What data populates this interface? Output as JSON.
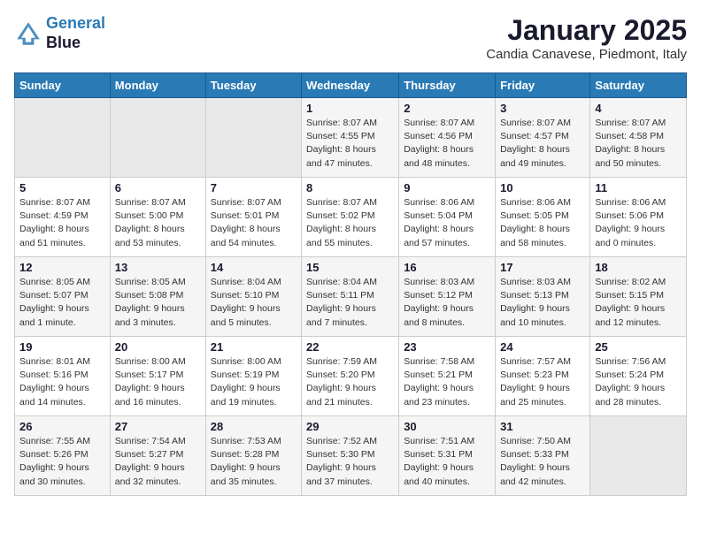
{
  "header": {
    "logo_line1": "General",
    "logo_line2": "Blue",
    "month": "January 2025",
    "location": "Candia Canavese, Piedmont, Italy"
  },
  "days_of_week": [
    "Sunday",
    "Monday",
    "Tuesday",
    "Wednesday",
    "Thursday",
    "Friday",
    "Saturday"
  ],
  "weeks": [
    [
      {
        "day": "",
        "info": ""
      },
      {
        "day": "",
        "info": ""
      },
      {
        "day": "",
        "info": ""
      },
      {
        "day": "1",
        "info": "Sunrise: 8:07 AM\nSunset: 4:55 PM\nDaylight: 8 hours and 47 minutes."
      },
      {
        "day": "2",
        "info": "Sunrise: 8:07 AM\nSunset: 4:56 PM\nDaylight: 8 hours and 48 minutes."
      },
      {
        "day": "3",
        "info": "Sunrise: 8:07 AM\nSunset: 4:57 PM\nDaylight: 8 hours and 49 minutes."
      },
      {
        "day": "4",
        "info": "Sunrise: 8:07 AM\nSunset: 4:58 PM\nDaylight: 8 hours and 50 minutes."
      }
    ],
    [
      {
        "day": "5",
        "info": "Sunrise: 8:07 AM\nSunset: 4:59 PM\nDaylight: 8 hours and 51 minutes."
      },
      {
        "day": "6",
        "info": "Sunrise: 8:07 AM\nSunset: 5:00 PM\nDaylight: 8 hours and 53 minutes."
      },
      {
        "day": "7",
        "info": "Sunrise: 8:07 AM\nSunset: 5:01 PM\nDaylight: 8 hours and 54 minutes."
      },
      {
        "day": "8",
        "info": "Sunrise: 8:07 AM\nSunset: 5:02 PM\nDaylight: 8 hours and 55 minutes."
      },
      {
        "day": "9",
        "info": "Sunrise: 8:06 AM\nSunset: 5:04 PM\nDaylight: 8 hours and 57 minutes."
      },
      {
        "day": "10",
        "info": "Sunrise: 8:06 AM\nSunset: 5:05 PM\nDaylight: 8 hours and 58 minutes."
      },
      {
        "day": "11",
        "info": "Sunrise: 8:06 AM\nSunset: 5:06 PM\nDaylight: 9 hours and 0 minutes."
      }
    ],
    [
      {
        "day": "12",
        "info": "Sunrise: 8:05 AM\nSunset: 5:07 PM\nDaylight: 9 hours and 1 minute."
      },
      {
        "day": "13",
        "info": "Sunrise: 8:05 AM\nSunset: 5:08 PM\nDaylight: 9 hours and 3 minutes."
      },
      {
        "day": "14",
        "info": "Sunrise: 8:04 AM\nSunset: 5:10 PM\nDaylight: 9 hours and 5 minutes."
      },
      {
        "day": "15",
        "info": "Sunrise: 8:04 AM\nSunset: 5:11 PM\nDaylight: 9 hours and 7 minutes."
      },
      {
        "day": "16",
        "info": "Sunrise: 8:03 AM\nSunset: 5:12 PM\nDaylight: 9 hours and 8 minutes."
      },
      {
        "day": "17",
        "info": "Sunrise: 8:03 AM\nSunset: 5:13 PM\nDaylight: 9 hours and 10 minutes."
      },
      {
        "day": "18",
        "info": "Sunrise: 8:02 AM\nSunset: 5:15 PM\nDaylight: 9 hours and 12 minutes."
      }
    ],
    [
      {
        "day": "19",
        "info": "Sunrise: 8:01 AM\nSunset: 5:16 PM\nDaylight: 9 hours and 14 minutes."
      },
      {
        "day": "20",
        "info": "Sunrise: 8:00 AM\nSunset: 5:17 PM\nDaylight: 9 hours and 16 minutes."
      },
      {
        "day": "21",
        "info": "Sunrise: 8:00 AM\nSunset: 5:19 PM\nDaylight: 9 hours and 19 minutes."
      },
      {
        "day": "22",
        "info": "Sunrise: 7:59 AM\nSunset: 5:20 PM\nDaylight: 9 hours and 21 minutes."
      },
      {
        "day": "23",
        "info": "Sunrise: 7:58 AM\nSunset: 5:21 PM\nDaylight: 9 hours and 23 minutes."
      },
      {
        "day": "24",
        "info": "Sunrise: 7:57 AM\nSunset: 5:23 PM\nDaylight: 9 hours and 25 minutes."
      },
      {
        "day": "25",
        "info": "Sunrise: 7:56 AM\nSunset: 5:24 PM\nDaylight: 9 hours and 28 minutes."
      }
    ],
    [
      {
        "day": "26",
        "info": "Sunrise: 7:55 AM\nSunset: 5:26 PM\nDaylight: 9 hours and 30 minutes."
      },
      {
        "day": "27",
        "info": "Sunrise: 7:54 AM\nSunset: 5:27 PM\nDaylight: 9 hours and 32 minutes."
      },
      {
        "day": "28",
        "info": "Sunrise: 7:53 AM\nSunset: 5:28 PM\nDaylight: 9 hours and 35 minutes."
      },
      {
        "day": "29",
        "info": "Sunrise: 7:52 AM\nSunset: 5:30 PM\nDaylight: 9 hours and 37 minutes."
      },
      {
        "day": "30",
        "info": "Sunrise: 7:51 AM\nSunset: 5:31 PM\nDaylight: 9 hours and 40 minutes."
      },
      {
        "day": "31",
        "info": "Sunrise: 7:50 AM\nSunset: 5:33 PM\nDaylight: 9 hours and 42 minutes."
      },
      {
        "day": "",
        "info": ""
      }
    ]
  ]
}
